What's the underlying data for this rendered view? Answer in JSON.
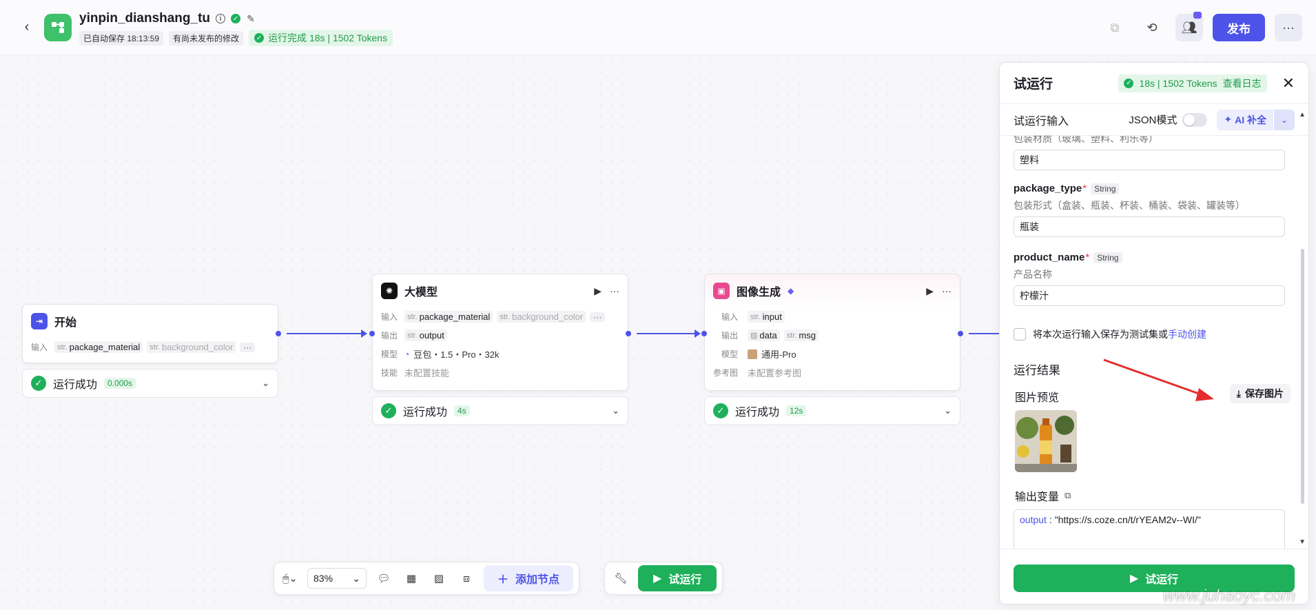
{
  "header": {
    "app_title": "yinpin_dianshang_tu",
    "autosave": "已自动保存 18:13:59",
    "unpublished": "有尚未发布的修改",
    "run_status": "运行完成 18s | 1502 Tokens",
    "publish_label": "发布"
  },
  "nodes": {
    "start": {
      "title": "开始",
      "input_label": "输入",
      "var1": "package_material",
      "var2": "background_color",
      "type_prefix": "str.",
      "status": "运行成功",
      "time": "0.000s"
    },
    "llm": {
      "title": "大模型",
      "input_label": "输入",
      "output_label": "输出",
      "model_label": "模型",
      "skill_label": "技能",
      "in1": "package_material",
      "in2": "background_color",
      "out1": "output",
      "model": "豆包・1.5・Pro・32k",
      "skill": "未配置技能",
      "type_prefix": "str.",
      "status": "运行成功",
      "time": "4s"
    },
    "image": {
      "title": "图像生成",
      "input_label": "输入",
      "output_label": "输出",
      "model_label": "模型",
      "ref_label": "参考图",
      "in1": "input",
      "out1": "data",
      "out2": "msg",
      "model": "通用-Pro",
      "ref": "未配置参考图",
      "type_prefix": "str.",
      "status": "运行成功",
      "time": "12s"
    }
  },
  "toolbar": {
    "zoom": "83%",
    "add_node": "添加节点",
    "run": "试运行"
  },
  "panel": {
    "title": "试运行",
    "stats": "18s | 1502 Tokens",
    "view_log": "查看日志",
    "input_title": "试运行输入",
    "json_mode": "JSON模式",
    "ai_fill": "AI 补全",
    "fields": [
      {
        "name": "",
        "type": "",
        "desc": "包装材质（玻璃、塑料、利乐等）",
        "value": "塑料"
      },
      {
        "name": "package_type",
        "type": "String",
        "desc": "包装形式（盒装、瓶装、杯装、桶装、袋装、罐装等）",
        "value": "瓶装"
      },
      {
        "name": "product_name",
        "type": "String",
        "desc": "产品名称",
        "value": "柠檬汁"
      }
    ],
    "save_testset_text": "将本次运行输入保存为测试集或",
    "manual_create": "手动创建",
    "result_title": "运行结果",
    "preview_title": "图片预览",
    "save_image": "保存图片",
    "output_vars_title": "输出变量",
    "output_key": "output",
    "output_value": "\"https://s.coze.cn/t/rYEAM2v--WI/\"",
    "run_label": "试运行"
  },
  "watermark": "www.juhaoyc.com",
  "colors": {
    "brand": "#4d53e8",
    "success": "#1eb05b",
    "app_icon": "#3ec16a"
  }
}
